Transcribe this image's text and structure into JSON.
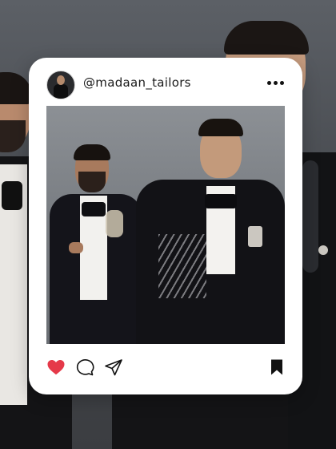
{
  "post": {
    "username": "@madaan_tailors",
    "avatar_alt": "profile-avatar",
    "photo_alt": "two-men-in-black-tuxedos",
    "liked": true
  },
  "icons": {
    "more": "more-dots-icon",
    "like": "heart-icon",
    "comment": "comment-bubble-icon",
    "share": "send-arrow-icon",
    "save": "bookmark-icon"
  },
  "colors": {
    "like_active": "#e53949",
    "icon_dark": "#111111",
    "card_bg": "#ffffff"
  }
}
